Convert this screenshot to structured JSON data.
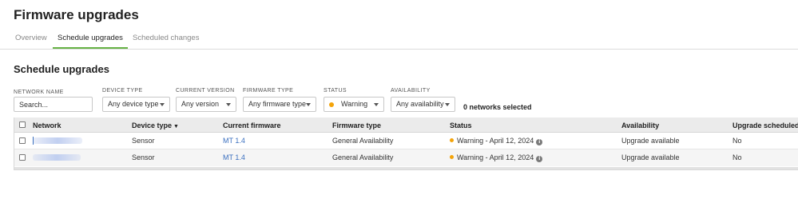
{
  "page": {
    "title": "Firmware upgrades"
  },
  "tabs": [
    {
      "label": "Overview",
      "active": false
    },
    {
      "label": "Schedule upgrades",
      "active": true
    },
    {
      "label": "Scheduled changes",
      "active": false
    }
  ],
  "section": {
    "title": "Schedule upgrades"
  },
  "filters": {
    "network_name": {
      "label": "NETWORK NAME",
      "placeholder": "Search...",
      "value": ""
    },
    "device_type": {
      "label": "DEVICE TYPE",
      "value": "Any device type"
    },
    "current_version": {
      "label": "CURRENT VERSION",
      "value": "Any version"
    },
    "firmware_type": {
      "label": "FIRMWARE TYPE",
      "value": "Any firmware type"
    },
    "status": {
      "label": "STATUS",
      "value": "Warning",
      "dot_color": "#f4a40a"
    },
    "availability": {
      "label": "AVAILABILITY",
      "value": "Any availability"
    }
  },
  "selection": {
    "text": "0 networks selected"
  },
  "table": {
    "columns": [
      "Network",
      "Device type",
      "Current firmware",
      "Firmware type",
      "Status",
      "Availability",
      "Upgrade scheduled"
    ],
    "sort_indicator": "▼",
    "rows": [
      {
        "device_type": "Sensor",
        "current_firmware": "MT 1.4",
        "firmware_type": "General Availability",
        "status": "Warning - April 12, 2024",
        "availability": "Upgrade available",
        "upgrade_scheduled": "No"
      },
      {
        "device_type": "Sensor",
        "current_firmware": "MT 1.4",
        "firmware_type": "General Availability",
        "status": "Warning - April 12, 2024",
        "availability": "Upgrade available",
        "upgrade_scheduled": "No"
      }
    ]
  },
  "colors": {
    "accent": "#67b346",
    "link": "#3a6fbf",
    "warning": "#f4a40a"
  }
}
